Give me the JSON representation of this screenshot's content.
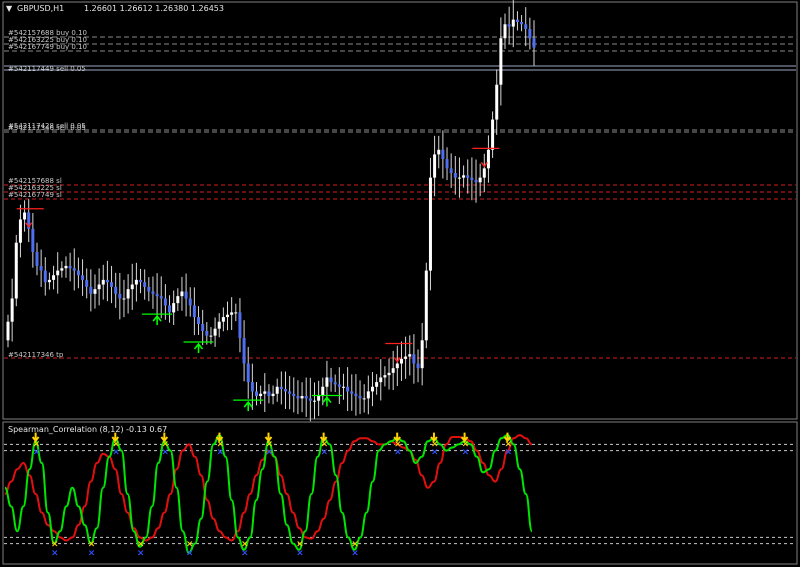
{
  "chart_data": [
    {
      "type": "candlestick",
      "title": "GBPUSD,H1",
      "ohlc_header": "1.26601 1.26612 1.26380 1.26453",
      "price_range": [
        1.25,
        1.267
      ],
      "bar_count": 128,
      "series": [
        {
          "name": "close",
          "values": [
            1.2538,
            1.2548,
            1.2572,
            1.2582,
            1.2585,
            1.2578,
            1.2568,
            1.2562,
            1.256,
            1.2555,
            1.2556,
            1.2558,
            1.256,
            1.2561,
            1.2562,
            1.2561,
            1.256,
            1.2558,
            1.2556,
            1.2553,
            1.255,
            1.2552,
            1.2554,
            1.2556,
            1.2555,
            1.2553,
            1.255,
            1.2548,
            1.2548,
            1.2552,
            1.2554,
            1.2556,
            1.2555,
            1.2553,
            1.2551,
            1.255,
            1.2549,
            1.2548,
            1.2545,
            1.2542,
            1.2546,
            1.2549,
            1.2551,
            1.2548,
            1.2545,
            1.254,
            1.2537,
            1.2534,
            1.2532,
            1.2532,
            1.2535,
            1.2538,
            1.254,
            1.2541,
            1.2542,
            1.2542,
            1.2531,
            1.252,
            1.2512,
            1.2508,
            1.2506,
            1.2507,
            1.2508,
            1.2506,
            1.2507,
            1.251,
            1.2509,
            1.2508,
            1.2507,
            1.2506,
            1.2505,
            1.2506,
            1.2505,
            1.2504,
            1.2504,
            1.2506,
            1.251,
            1.2514,
            1.2512,
            1.2511,
            1.251,
            1.251,
            1.2508,
            1.2507,
            1.2506,
            1.2505,
            1.2505,
            1.2508,
            1.251,
            1.2512,
            1.2514,
            1.2515,
            1.2516,
            1.2518,
            1.252,
            1.2522,
            1.2523,
            1.2524,
            1.252,
            1.2518,
            1.253,
            1.256,
            1.26,
            1.261,
            1.2612,
            1.2608,
            1.2604,
            1.2602,
            1.26,
            1.26,
            1.2601,
            1.26,
            1.2599,
            1.2598,
            1.26,
            1.2604,
            1.2612,
            1.2625,
            1.264,
            1.266,
            1.2666,
            1.2665,
            1.2668,
            1.2667,
            1.2666,
            1.2664,
            1.266,
            1.2656
          ]
        }
      ],
      "trade_labels": [
        "#542157688 buy 0.10",
        "#542163225 buy 0.10",
        "#542167749 buy 0.10",
        "#542117449 sell 0.05",
        "#542117428 sell 0.05",
        "#542117346 sell 0.05",
        "#542157688 sl",
        "#542163225 sl",
        "#542167749 sl",
        "#542117346 tp"
      ],
      "colors": {
        "background": "#000000",
        "candle_up": "#ffffff",
        "candle_down": "#4f6ff0",
        "level_dash": "#8a8a8a",
        "sl_line": "#d02020",
        "buy_arrow": "#00ff00",
        "sell_arrow": "#ff2020"
      }
    },
    {
      "type": "line",
      "title": "Spearman_Correlation (8,12) -0.13 0.67",
      "ylim": [
        -1,
        1
      ],
      "levels": [
        0.8,
        0.7,
        -0.7,
        -0.8
      ],
      "series": [
        {
          "name": "green",
          "color": "#00e600",
          "values": [
            0.1,
            -0.2,
            -0.6,
            -0.2,
            0.4,
            0.85,
            0.5,
            -0.3,
            -0.8,
            -0.6,
            -0.2,
            0.1,
            -0.2,
            -0.5,
            -0.8,
            -0.55,
            0.1,
            0.6,
            0.9,
            0.7,
            0.0,
            -0.6,
            -0.85,
            -0.7,
            -0.2,
            0.5,
            0.85,
            0.7,
            0.1,
            -0.6,
            -0.95,
            -0.8,
            -0.4,
            0.2,
            0.8,
            0.95,
            0.6,
            -0.1,
            -0.7,
            -0.9,
            -0.7,
            -0.1,
            0.4,
            0.85,
            0.6,
            0.0,
            -0.5,
            -0.8,
            -0.9,
            -0.6,
            0.0,
            0.6,
            0.9,
            0.8,
            0.3,
            -0.3,
            -0.7,
            -0.9,
            -0.7,
            -0.3,
            0.2,
            0.7,
            0.8,
            0.85,
            0.9,
            0.85,
            0.7,
            0.5,
            0.6,
            0.85,
            0.9,
            0.8,
            0.7,
            0.75,
            0.8,
            0.85,
            0.8,
            0.6,
            0.35,
            0.4,
            0.7,
            0.9,
            0.95,
            0.8,
            0.4,
            0.0,
            -0.6
          ]
        },
        {
          "name": "red",
          "color": "#e01010",
          "values": [
            0.0,
            0.2,
            0.4,
            0.5,
            0.3,
            0.0,
            -0.3,
            -0.5,
            -0.6,
            -0.7,
            -0.75,
            -0.7,
            -0.5,
            -0.2,
            0.2,
            0.5,
            0.65,
            0.6,
            0.4,
            0.0,
            -0.3,
            -0.55,
            -0.7,
            -0.75,
            -0.7,
            -0.55,
            -0.3,
            0.0,
            0.4,
            0.7,
            0.8,
            0.6,
            0.3,
            -0.1,
            -0.4,
            -0.6,
            -0.7,
            -0.75,
            -0.6,
            -0.3,
            0.0,
            0.3,
            0.55,
            0.7,
            0.6,
            0.3,
            0.0,
            -0.3,
            -0.55,
            -0.7,
            -0.72,
            -0.6,
            -0.4,
            -0.1,
            0.2,
            0.5,
            0.7,
            0.85,
            0.9,
            0.9,
            0.85,
            0.8,
            0.8,
            0.85,
            0.8,
            0.75,
            0.7,
            0.55,
            0.3,
            0.1,
            0.2,
            0.5,
            0.8,
            0.92,
            0.92,
            0.9,
            0.85,
            0.7,
            0.5,
            0.3,
            0.2,
            0.4,
            0.7,
            0.9,
            0.95,
            0.9,
            0.8
          ]
        }
      ]
    }
  ]
}
